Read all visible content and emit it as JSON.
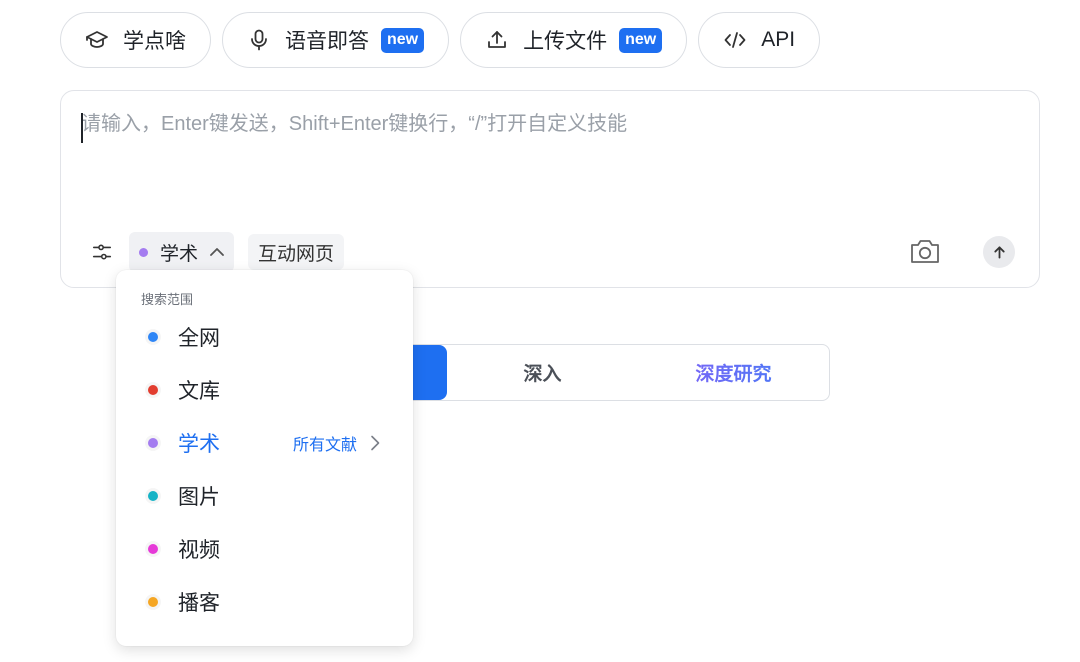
{
  "chips": [
    {
      "label": "学点啥",
      "icon": "graduation-cap-icon",
      "badge": ""
    },
    {
      "label": "语音即答",
      "icon": "microphone-icon",
      "badge": "new"
    },
    {
      "label": "上传文件",
      "icon": "upload-icon",
      "badge": "new"
    },
    {
      "label": "API",
      "icon": "code-icon",
      "badge": ""
    }
  ],
  "composer": {
    "placeholder": "请输入，Enter键发送，Shift+Enter键换行，“/”打开自定义技能",
    "value": "",
    "scope_label": "学术",
    "web_label": "互动网页"
  },
  "modes": {
    "items": [
      "",
      "深入",
      "深度研究"
    ],
    "active_index": 0
  },
  "dropdown": {
    "heading": "搜索范围",
    "items": [
      {
        "label": "全网",
        "color": "#2f86f6"
      },
      {
        "label": "文库",
        "color": "#e23d2f"
      },
      {
        "label": "学术",
        "color": "#a47cf0",
        "selected": true,
        "sub_label": "所有文献"
      },
      {
        "label": "图片",
        "color": "#16b3c6"
      },
      {
        "label": "视频",
        "color": "#e63ad8"
      },
      {
        "label": "播客",
        "color": "#f5a623"
      }
    ]
  },
  "colors": {
    "accent": "#1e6ff1",
    "scope_dot": "#a47cf0"
  }
}
